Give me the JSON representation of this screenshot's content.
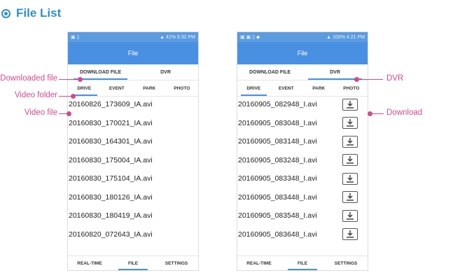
{
  "header": {
    "title": "File List"
  },
  "callouts": {
    "downloaded_file": "Downloaded file",
    "video_folder": "Video folder",
    "video_file": "Video file",
    "dvr": "DVR",
    "download": "Download"
  },
  "left_phone": {
    "status_time": "5:32 PM",
    "status_battery": "41%",
    "title": "File",
    "top_tabs": [
      "DOWNLOAD FILE",
      "DVR"
    ],
    "sub_tabs": [
      "DRIVE",
      "EVENT",
      "PARK",
      "PHOTO"
    ],
    "files": [
      "20160826_173609_IA.avi",
      "20160830_170021_IA.avi",
      "20160830_164301_IA.avi",
      "20160830_175004_IA.avi",
      "20160830_175104_IA.avi",
      "20160830_180126_IA.avi",
      "20160830_180419_IA.avi",
      "20160820_072643_IA.avi"
    ],
    "bottom_nav": [
      "REAL-TIME",
      "FILE",
      "SETTINGS"
    ]
  },
  "right_phone": {
    "status_time": "4:21 PM",
    "status_battery": "100%",
    "title": "File",
    "top_tabs": [
      "DOWNLOAD FILE",
      "DVR"
    ],
    "sub_tabs": [
      "DRIVE",
      "EVENT",
      "PARK",
      "PHOTO"
    ],
    "files": [
      "20160905_082948_I.avi",
      "20160905_083048_I.avi",
      "20160905_083148_I.avi",
      "20160905_083248_I.avi",
      "20160905_083348_I.avi",
      "20160905_083448_I.avi",
      "20160905_083548_I.avi",
      "20160905_083648_I.avi"
    ],
    "bottom_nav": [
      "REAL-TIME",
      "FILE",
      "SETTINGS"
    ]
  },
  "colors": {
    "accent": "#4a90e2",
    "callout": "#d24a8e",
    "heading": "#2f8fd0"
  }
}
